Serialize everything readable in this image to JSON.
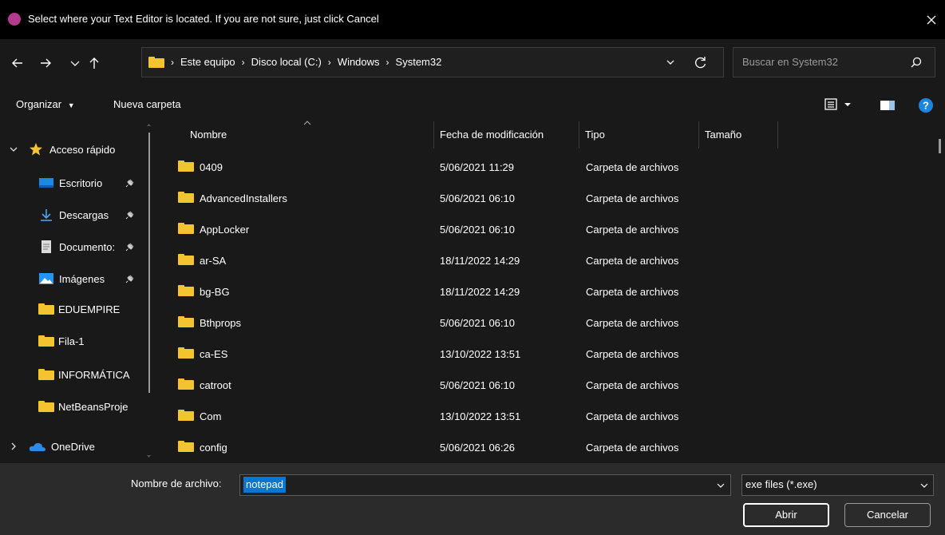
{
  "window": {
    "title": "Select where your Text Editor is located. If you are not sure, just click Cancel"
  },
  "address": {
    "breadcrumbs": [
      "Este equipo",
      "Disco local (C:)",
      "Windows",
      "System32"
    ],
    "search_placeholder": "Buscar en System32"
  },
  "commands": {
    "organize": "Organizar",
    "new_folder": "Nueva carpeta"
  },
  "nav": {
    "quick_access": "Acceso rápido",
    "items": [
      {
        "label": "Escritorio",
        "icon": "desktop-icon",
        "pinned": true
      },
      {
        "label": "Descargas",
        "icon": "download-icon",
        "pinned": true
      },
      {
        "label": "Documento:",
        "icon": "document-icon",
        "pinned": true
      },
      {
        "label": "Imágenes",
        "icon": "image-icon",
        "pinned": true
      },
      {
        "label": "EDUEMPIRE",
        "icon": "folder-icon",
        "pinned": false
      },
      {
        "label": "Fila-1",
        "icon": "folder-icon",
        "pinned": false
      },
      {
        "label": "INFORMÁTICA",
        "icon": "folder-icon",
        "pinned": false
      },
      {
        "label": "NetBeansProje",
        "icon": "folder-icon",
        "pinned": false
      }
    ],
    "onedrive": "OneDrive"
  },
  "columns": {
    "name": "Nombre",
    "modified": "Fecha de modificación",
    "type": "Tipo",
    "size": "Tamaño"
  },
  "files": [
    {
      "name": "0409",
      "modified": "5/06/2021 11:29",
      "type": "Carpeta de archivos"
    },
    {
      "name": "AdvancedInstallers",
      "modified": "5/06/2021 06:10",
      "type": "Carpeta de archivos"
    },
    {
      "name": "AppLocker",
      "modified": "5/06/2021 06:10",
      "type": "Carpeta de archivos"
    },
    {
      "name": "ar-SA",
      "modified": "18/11/2022 14:29",
      "type": "Carpeta de archivos"
    },
    {
      "name": "bg-BG",
      "modified": "18/11/2022 14:29",
      "type": "Carpeta de archivos"
    },
    {
      "name": "Bthprops",
      "modified": "5/06/2021 06:10",
      "type": "Carpeta de archivos"
    },
    {
      "name": "ca-ES",
      "modified": "13/10/2022 13:51",
      "type": "Carpeta de archivos"
    },
    {
      "name": "catroot",
      "modified": "5/06/2021 06:10",
      "type": "Carpeta de archivos"
    },
    {
      "name": "Com",
      "modified": "13/10/2022 13:51",
      "type": "Carpeta de archivos"
    },
    {
      "name": "config",
      "modified": "5/06/2021 06:26",
      "type": "Carpeta de archivos"
    }
  ],
  "bottom": {
    "filename_label": "Nombre de archivo:",
    "filename_value": "notepad",
    "filetype_value": "exe files (*.exe)",
    "open_label": "Abrir",
    "cancel_label": "Cancelar"
  },
  "colors": {
    "folder": "#f4c430",
    "accent": "#0078d4",
    "background": "#191919",
    "titlebar": "#000000"
  }
}
